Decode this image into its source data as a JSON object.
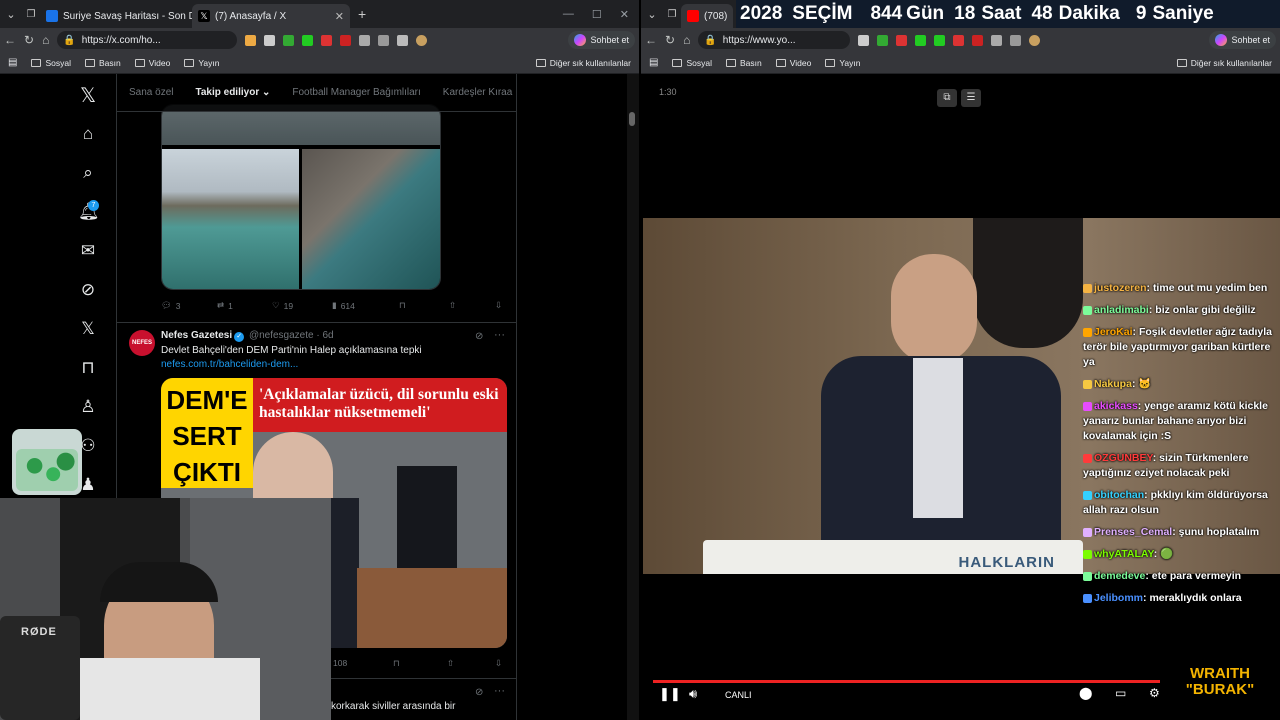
{
  "left_window": {
    "tabs": [
      {
        "label": "Suriye Savaş Haritası - Son Dakika",
        "active": false
      },
      {
        "label": "(7) Anasayfa / X",
        "active": true
      }
    ],
    "address": "https://x.com/ho...",
    "chat_button": "Sohbet et",
    "bookmarks": [
      "Sosyal",
      "Basın",
      "Video",
      "Yayın"
    ],
    "bookmarks_other": "Diğer sık kullanılanlar"
  },
  "x_nav": {
    "items": [
      "x-logo-icon",
      "home-icon",
      "search-icon",
      "bell-icon",
      "mail-icon",
      "grok-icon",
      "x-premium-icon",
      "bookmark-icon",
      "jobs-icon",
      "communities-icon",
      "profile-icon"
    ],
    "notification_count": "7"
  },
  "feed": {
    "tabs": [
      "Sana özel",
      "Takip ediliyor",
      "Football Manager Bağımlıları",
      "Kardeşler Kıraa"
    ],
    "prev_tweet_actions": {
      "replies": "3",
      "retweets": "1",
      "likes": "19",
      "views": "614"
    },
    "tweet": {
      "avatar_text": "NEFES",
      "name": "Nefes Gazetesi",
      "handle": "@nefesgazete",
      "time": "· 6d",
      "text": "Devlet Bahçeli'den DEM Parti'nin Halep açıklamasına tepki",
      "link": "nefes.com.tr/bahceliden-dem...",
      "image_headline_left": "DEM'E SERT ÇIKTI",
      "image_headline_right": "'Açıklamalar üzücü, dil sorunlu eski hastalıklar nüksetmemeli'",
      "views": "108"
    },
    "next_tweet_fragment": "korkarak siviller arasında bir"
  },
  "webcam": {
    "mic_brand": "RØDE"
  },
  "right_window": {
    "tab_label": "(708)",
    "banner": {
      "year": "2028",
      "title": "SEÇİM",
      "days": "844",
      "days_label": "Gün",
      "hours": "18",
      "hours_label": "Saat",
      "minutes": "48",
      "minutes_label": "Dakika",
      "seconds": "9",
      "seconds_label": "Saniye"
    },
    "address": "https://www.yo...",
    "chat_button": "Sohbet et",
    "bookmarks": [
      "Sosyal",
      "Basın",
      "Video",
      "Yayın"
    ],
    "bookmarks_other": "Diğer sık kullanılanlar"
  },
  "player": {
    "time_label": "1:30",
    "live_label": "CANLI",
    "podium_text": "HALKLARIN"
  },
  "chat": [
    {
      "user": "justozeren",
      "color": "#f5b342",
      "text": "time out mu yedim ben"
    },
    {
      "user": "anladimabi",
      "color": "#7cfc9a",
      "text": "biz onlar gibi değiliz"
    },
    {
      "user": "JeroKai",
      "color": "#ffa500",
      "text": "Foşik devletler ağız tadıyla terör bile yaptırmıyor gariban kürtlere ya"
    },
    {
      "user": "Nakupa",
      "color": "#f5c842",
      "text": "🐱"
    },
    {
      "user": "akickass",
      "color": "#e74cff",
      "text": "yenge aramız kötü kickle yanarız bunlar bahane arıyor bizi kovalamak için :S"
    },
    {
      "user": "OZGUNBEY",
      "color": "#ff3b3b",
      "text": "sizin Türkmenlere yaptığınız eziyet nolacak peki"
    },
    {
      "user": "obitochan",
      "color": "#33d1ff",
      "text": "pkklıyı kim öldürüyorsa allah razı olsun"
    },
    {
      "user": "Prenses_Cemal",
      "color": "#e0b0ff",
      "text": "şunu hoplatalım"
    },
    {
      "user": "whyATALAY",
      "color": "#7cfc00",
      "text": "🟢"
    },
    {
      "user": "demedeve",
      "color": "#7cfc9a",
      "text": "ete para vermeyin"
    },
    {
      "user": "Jelibomm",
      "color": "#4a90ff",
      "text": "meraklıydık onlara"
    }
  ],
  "logo": {
    "line1": "WRAITH",
    "line2": "\"BURAK\""
  },
  "colors": {
    "x_blue": "#1d9bf0",
    "live_red": "#e22",
    "banner_bg": "#101b2b"
  }
}
